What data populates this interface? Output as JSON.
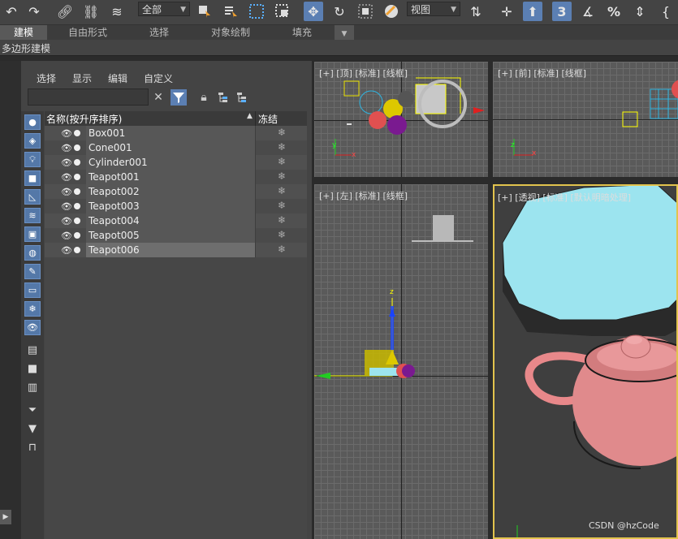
{
  "toolbar": {
    "selection_filter": "全部",
    "reference_coord": "视图",
    "icons": [
      "undo-icon",
      "redo-icon",
      "link-icon",
      "unlink-icon",
      "bind-spacewarp-icon",
      "select-object-icon",
      "select-by-name-icon",
      "rect-selection-icon",
      "window-crossing-icon",
      "move-icon",
      "rotate-icon",
      "scale-icon",
      "place-icon",
      "pivot-icon",
      "snap-3d-icon",
      "angle-snap-icon",
      "percent-snap-icon",
      "spinner-snap-icon"
    ]
  },
  "ribbon": {
    "tabs": [
      {
        "label": "建模",
        "active": true
      },
      {
        "label": "自由形式",
        "active": false
      },
      {
        "label": "选择",
        "active": false
      },
      {
        "label": "对象绘制",
        "active": false
      },
      {
        "label": "填充",
        "active": false
      }
    ],
    "sub_label": "多边形建模"
  },
  "explorer": {
    "menu": [
      "选择",
      "显示",
      "编辑",
      "自定义"
    ],
    "search_value": "",
    "columns": {
      "name": "名称(按升序排序)",
      "sort": "▲",
      "frozen": "冻结"
    },
    "rows": [
      {
        "name": "Box001",
        "selected": false
      },
      {
        "name": "Cone001",
        "selected": false
      },
      {
        "name": "Cylinder001",
        "selected": false
      },
      {
        "name": "Teapot001",
        "selected": false
      },
      {
        "name": "Teapot002",
        "selected": false
      },
      {
        "name": "Teapot003",
        "selected": false
      },
      {
        "name": "Teapot004",
        "selected": false
      },
      {
        "name": "Teapot005",
        "selected": false
      },
      {
        "name": "Teapot006",
        "selected": true
      }
    ]
  },
  "viewports": {
    "top": "[+] [顶] [标准] [线框]",
    "front": "[+] [前] [标准] [线框]",
    "left": "[+] [左] [标准] [线框]",
    "perspective": "[+] [透视] [标准] [默认明暗处理]"
  },
  "axes": {
    "x": "x",
    "y": "y",
    "z": "z"
  },
  "watermark": "CSDN @hzCode",
  "colors": {
    "accent": "#5b7fb3",
    "active_viewport": "#e2c34d",
    "cylinder": "#9ce4ef",
    "teapot": "#e8888a"
  }
}
